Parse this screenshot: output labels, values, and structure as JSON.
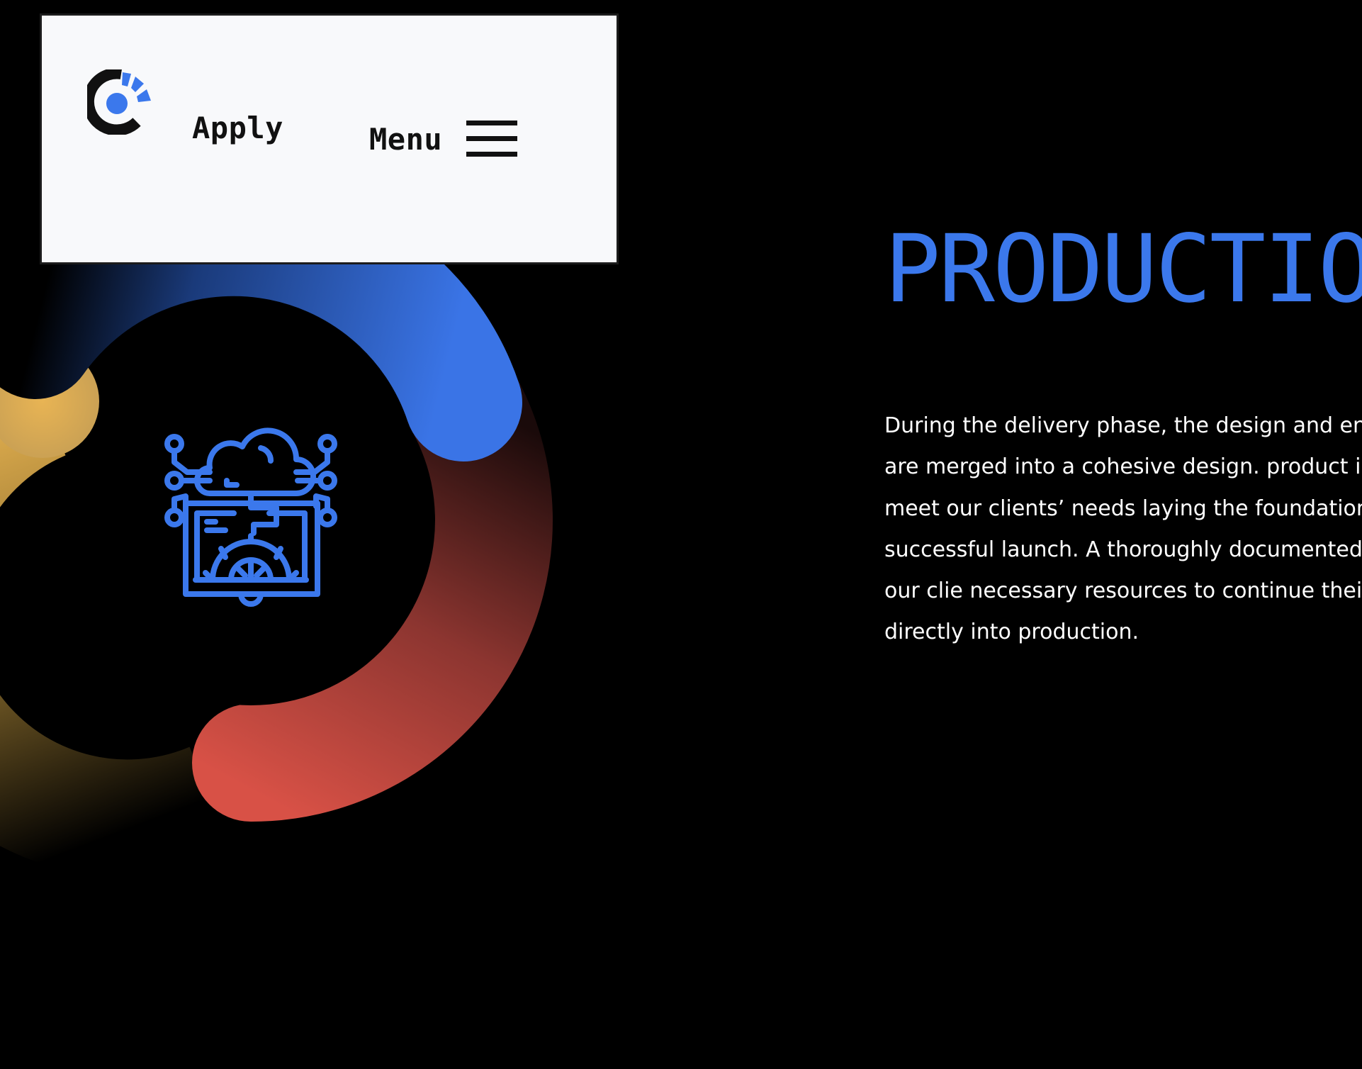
{
  "header": {
    "logo_icon": "brand-logo-icon",
    "apply_label": "Apply",
    "menu_label": "Menu",
    "menu_icon": "hamburger-icon"
  },
  "section": {
    "title": "PRODUCTIO",
    "icon": "cloud-circuit-gear-icon",
    "description": "During the delivery phase, the design and engi prototypes are merged into a cohesive design. product is validated to meet our clients’ needs laying the foundation for a successful launch. A thoroughly documented to ensure that our clie necessary resources to continue their developr directly into production."
  },
  "colors": {
    "background": "#000000",
    "accent_blue": "#3b78ec",
    "accent_red": "#d65146",
    "accent_gold": "#e3b04f",
    "card_background": "#f8f9fb",
    "text": "#ffffff"
  }
}
